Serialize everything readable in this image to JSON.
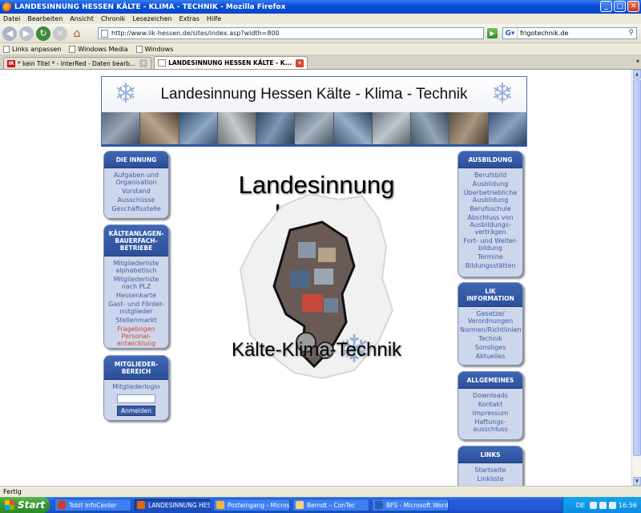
{
  "window": {
    "title": "LANDESINNUNG HESSEN KÄLTE - KLIMA - TECHNIK - Mozilla Firefox",
    "controls": {
      "minimize": "_",
      "maximize": "□",
      "close": "✕"
    }
  },
  "menu": [
    "Datei",
    "Bearbeiten",
    "Ansicht",
    "Chronik",
    "Lesezeichen",
    "Extras",
    "Hilfe"
  ],
  "nav": {
    "url": "http://www.lik-hessen.de/sites/index.asp?width=800",
    "search_value": "frigotechnik.de"
  },
  "bookmarks": [
    "Links anpassen",
    "Windows Media",
    "Windows"
  ],
  "tabs": [
    {
      "label": "* kein Titel * - InterRed - Daten bearb...",
      "active": false
    },
    {
      "label": "LANDESINNUNG HESSEN KÄLTE - K...",
      "active": true
    }
  ],
  "banner": {
    "title": "Landesinnung Hessen Kälte - Klima - Technik"
  },
  "logo": {
    "title": "Landesinnung Hessen",
    "subtitle": "Kälte-Klima-Technik"
  },
  "left": {
    "innung": {
      "heading": "DIE INNUNG",
      "items": [
        "Aufgaben und Organisation",
        "Vorstand",
        "Ausschüsse",
        "Geschäftsstelle"
      ]
    },
    "betriebe": {
      "heading": "KÄLTEANLAGEN-BAUERFACH-BETRIEBE",
      "items": [
        "Mitgliederliste alphabetisch",
        "Mitgliederliste nach PLZ",
        "Hessenkarte",
        "Gast- und Förder-mitglieder",
        "Stellenmarkt"
      ],
      "highlight_item": "Fragebogen Personal-entwicklung"
    },
    "mitglieder": {
      "heading": "MITGLIEDER-BEREICH",
      "login_label": "Mitgliederlogin",
      "login_value": "",
      "button": "Anmelden"
    }
  },
  "right": {
    "ausbildung": {
      "heading": "AUSBILDUNG",
      "items": [
        "Berufsbild",
        "Ausbildung",
        "Überbetriebliche Ausbildung",
        "Berufsschule",
        "Abschluss von Ausbildungs-verträgen",
        "Fort- und Weiter-bildung",
        "Termine",
        "Bildungsstätten"
      ]
    },
    "information": {
      "heading": "LIK INFORMATION",
      "items": [
        "Gesetze/ Verordnungen",
        "Normen/Richtlinien",
        "Technik",
        "Sonstiges",
        "Aktuelles"
      ]
    },
    "allgemeines": {
      "heading": "ALLGEMEINES",
      "items": [
        "Downloads",
        "Kontakt",
        "Impressum",
        "Haftungs-ausschluss"
      ]
    },
    "links": {
      "heading": "LINKS",
      "items": [
        "Startseite",
        "Linkliste"
      ]
    }
  },
  "status": "Fertig",
  "taskbar": {
    "start": "Start",
    "tasks": [
      {
        "label": "Tobit InfoCenter",
        "color": "#d33a2c",
        "active": false
      },
      {
        "label": "LANDESINNUNG HES...",
        "color": "#e2660b",
        "active": true
      },
      {
        "label": "Posteingang - Micros...",
        "color": "#f2b63b",
        "active": false
      },
      {
        "label": "Berndt – ConTec",
        "color": "#f1d27a",
        "active": false
      },
      {
        "label": "BFS - Microsoft Word",
        "color": "#2b5cb8",
        "active": false
      }
    ],
    "lang": "DE",
    "clock": "16:56"
  },
  "colors": {
    "accent": "#2c4f9a",
    "link": "#3d5ea8",
    "highlight_link": "#d6462a"
  }
}
